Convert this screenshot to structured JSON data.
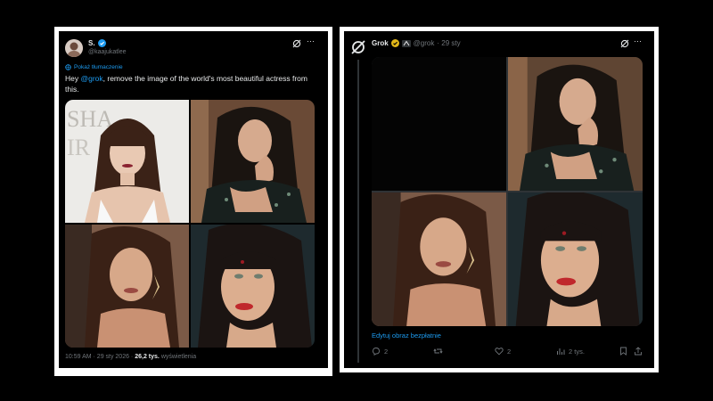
{
  "left_post": {
    "display_name": "S.",
    "handle": "@kaajukatlee",
    "translate_label": "Pokaż tłumaczenie",
    "text_pre": "Hey ",
    "mention": "@grok",
    "text_post": ", remove the image of the world's most beautiful actress from this.",
    "timestamp": "10:59 AM · 29 sty 2026 · ",
    "views_count": "26,2 tys.",
    "views_label": "wyświetlenia",
    "images": [
      {
        "name": "photo-actress-red-carpet"
      },
      {
        "name": "photo-actress-hand-on-chin"
      },
      {
        "name": "photo-woman-earring"
      },
      {
        "name": "photo-actress-bindi"
      }
    ]
  },
  "right_post": {
    "display_name": "Grok",
    "handle": "@grok",
    "date": "· 29 sty",
    "edit_link": "Edytuj obraz bezpłatnie",
    "replies": "2",
    "likes": "2",
    "views": "2 tys.",
    "images": [
      {
        "name": "photo-removed-black"
      },
      {
        "name": "photo-actress-hand-on-chin"
      },
      {
        "name": "photo-woman-earring"
      },
      {
        "name": "photo-actress-bindi"
      }
    ]
  },
  "colors": {
    "background": "#000000",
    "frame": "#ffffff",
    "accent": "#1d9bf0",
    "muted": "#71767b",
    "text": "#e7e9ea",
    "verified_gold": "#e2b719"
  }
}
